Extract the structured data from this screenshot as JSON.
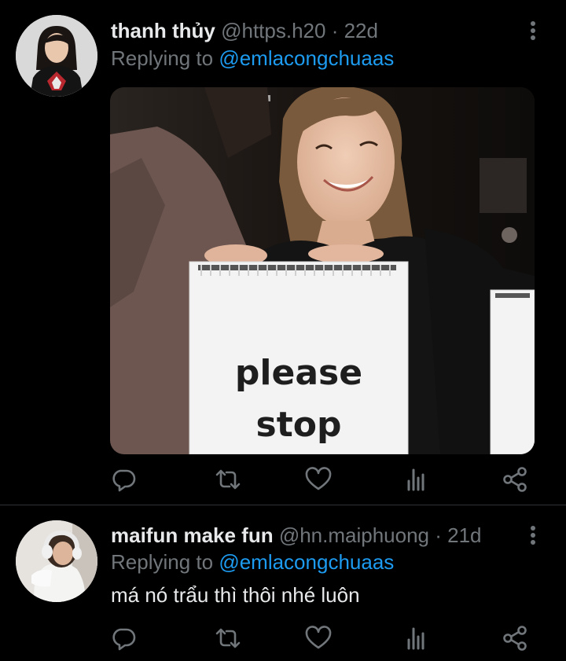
{
  "tweets": [
    {
      "name": "thanh thủy",
      "handle": "@https.h20",
      "dot": " · ",
      "time": "22d",
      "replying_prefix": "Replying to ",
      "replying_to": "@emlacongchuaas",
      "media": {
        "sign_line1": "please",
        "sign_line2": "stop"
      }
    },
    {
      "name": "maifun make fun",
      "handle": "@hn.maiphuong",
      "dot": " · ",
      "time": "21d",
      "replying_prefix": "Replying to ",
      "replying_to": "@emlacongchuaas",
      "text": "má nó trẩu thì thôi nhé luôn"
    }
  ],
  "icons": {
    "reply": "reply-icon",
    "retweet": "retweet-icon",
    "like": "heart-icon",
    "views": "views-icon",
    "share": "share-icon",
    "more": "more-vertical-icon"
  },
  "colors": {
    "background": "#000000",
    "text": "#e7e9ea",
    "muted": "#71767b",
    "link": "#1d9bf0",
    "divider": "#2f3336"
  }
}
